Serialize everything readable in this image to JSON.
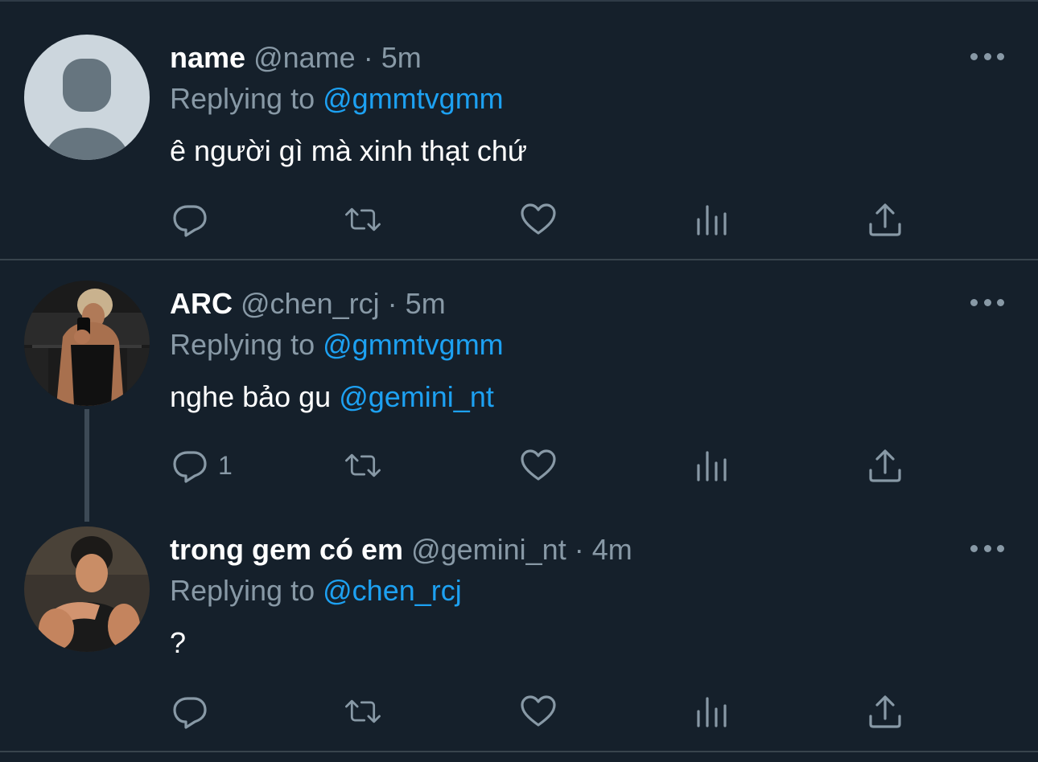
{
  "tweets": [
    {
      "display_name": "name",
      "handle": "@name",
      "time": "5m",
      "replying_label": "Replying to",
      "replying_to": "@gmmtvgmm",
      "text_before": "ê người gì mà xinh thạt chứ",
      "mention": "",
      "reply_count": "",
      "avatar": "default-avatar"
    },
    {
      "display_name": "ARC",
      "handle": "@chen_rcj",
      "time": "5m",
      "replying_label": "Replying to",
      "replying_to": "@gmmtvgmm",
      "text_before": "nghe bảo gu ",
      "mention": "@gemini_nt",
      "reply_count": "1",
      "avatar": "photo-avatar"
    },
    {
      "display_name": "trong gem có em",
      "handle": "@gemini_nt",
      "time": "4m",
      "replying_label": "Replying to",
      "replying_to": "@chen_rcj",
      "text_before": "?",
      "mention": "",
      "reply_count": "",
      "avatar": "photo-avatar"
    }
  ],
  "separator": "·",
  "colors": {
    "background": "#15202b",
    "muted": "#8899a6",
    "accent": "#1da1f2",
    "divider": "#38444d"
  },
  "icons": [
    "reply-icon",
    "retweet-icon",
    "like-icon",
    "analytics-icon",
    "share-icon",
    "more-icon"
  ]
}
